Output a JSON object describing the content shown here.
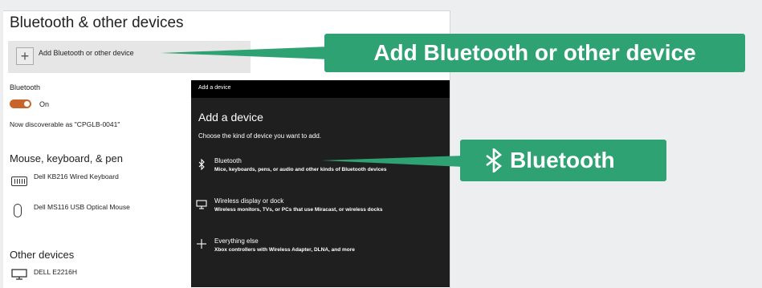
{
  "settings": {
    "title": "Bluetooth & other devices",
    "add_button_label": "Add Bluetooth or other device",
    "bluetooth_heading": "Bluetooth",
    "toggle_state": "On",
    "discoverable_text": "Now discoverable as \"CPGLB-0041\"",
    "mouse_section_heading": "Mouse, keyboard, & pen",
    "devices": [
      {
        "name": "Dell KB216 Wired Keyboard",
        "icon": "keyboard-icon"
      },
      {
        "name": "Dell MS116 USB Optical Mouse",
        "icon": "mouse-icon"
      }
    ],
    "other_section_heading": "Other devices",
    "other_devices": [
      {
        "name": "DELL E2216H",
        "icon": "monitor-icon"
      }
    ]
  },
  "dialog": {
    "window_title": "Add a device",
    "title": "Add a device",
    "subtitle": "Choose the kind of device you want to add.",
    "options": [
      {
        "title": "Bluetooth",
        "description": "Mice, keyboards, pens, or audio and other kinds of Bluetooth devices",
        "icon": "bluetooth-icon"
      },
      {
        "title": "Wireless display or dock",
        "description": "Wireless monitors, TVs, or PCs that use Miracast, or wireless docks",
        "icon": "display-icon"
      },
      {
        "title": "Everything else",
        "description": "Xbox controllers with Wireless Adapter, DLNA, and more",
        "icon": "plus-icon"
      }
    ]
  },
  "callouts": {
    "add": "Add Bluetooth or other device",
    "bluetooth": "Bluetooth"
  },
  "colors": {
    "callout": "#2ea272",
    "toggle_on": "#c7642a",
    "dialog_bg": "#1f1f1f"
  }
}
